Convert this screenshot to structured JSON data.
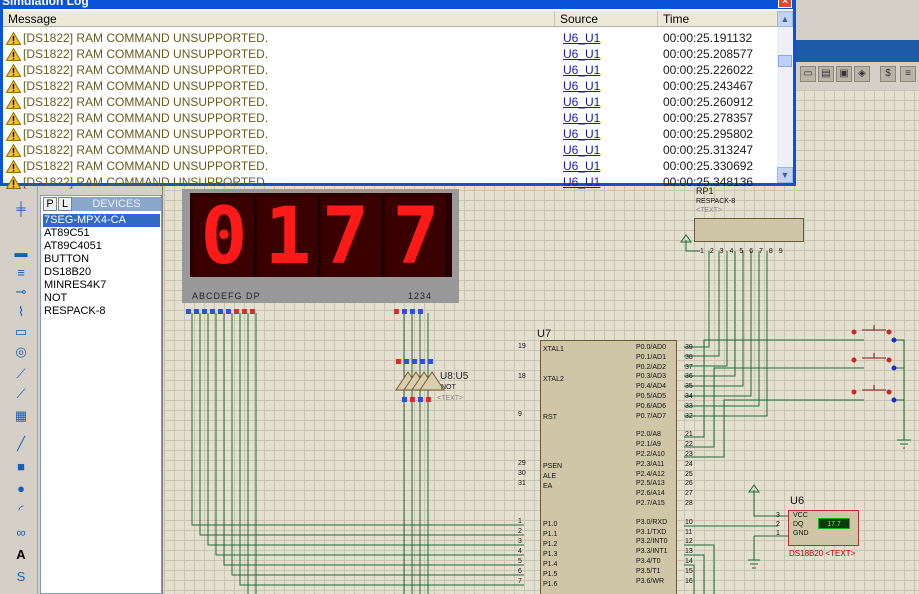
{
  "log": {
    "title": "Simulation Log",
    "columns": [
      "Message",
      "Source",
      "Time"
    ],
    "rows": [
      {
        "message": "[DS1822] RAM COMMAND UNSUPPORTED.",
        "source": "U6_U1",
        "time": "00:00:25.191132"
      },
      {
        "message": "[DS1822] RAM COMMAND UNSUPPORTED.",
        "source": "U6_U1",
        "time": "00:00:25.208577"
      },
      {
        "message": "[DS1822] RAM COMMAND UNSUPPORTED.",
        "source": "U6_U1",
        "time": "00:00:25.226022"
      },
      {
        "message": "[DS1822] RAM COMMAND UNSUPPORTED.",
        "source": "U6_U1",
        "time": "00:00:25.243467"
      },
      {
        "message": "[DS1822] RAM COMMAND UNSUPPORTED.",
        "source": "U6_U1",
        "time": "00:00:25.260912"
      },
      {
        "message": "[DS1822] RAM COMMAND UNSUPPORTED.",
        "source": "U6_U1",
        "time": "00:00:25.278357"
      },
      {
        "message": "[DS1822] RAM COMMAND UNSUPPORTED.",
        "source": "U6_U1",
        "time": "00:00:25.295802"
      },
      {
        "message": "[DS1822] RAM COMMAND UNSUPPORTED.",
        "source": "U6_U1",
        "time": "00:00:25.313247"
      },
      {
        "message": "[DS1822] RAM COMMAND UNSUPPORTED.",
        "source": "U6_U1",
        "time": "00:00:25.330692"
      },
      {
        "message": "[DS1822] RAM COMMAND UNSUPPORTED.",
        "source": "U6_U1",
        "time": "00:00:25.348136"
      }
    ],
    "close_glyph": "×",
    "scroll_up": "▲",
    "scroll_down": "▼"
  },
  "devices": {
    "tab_p": "P",
    "tab_l": "L",
    "header": "DEVICES",
    "items": [
      "7SEG-MPX4-CA",
      "AT89C51",
      "AT89C4051",
      "BUTTON",
      "DS18B20",
      "MINRES4K7",
      "NOT",
      "RESPACK-8"
    ],
    "selected_index": 0
  },
  "display": {
    "digits": [
      "0",
      "1",
      "7.",
      "7"
    ],
    "segment_label": "ABCDEFG  DP",
    "digit_label": "1234"
  },
  "mcu": {
    "ref": "U7",
    "left_pins": [
      {
        "num": "19",
        "name": "XTAL1"
      },
      {
        "num": "18",
        "name": "XTAL2"
      },
      {
        "num": "9",
        "name": "RST"
      },
      {
        "num": "29",
        "name": "PSEN"
      },
      {
        "num": "30",
        "name": "ALE"
      },
      {
        "num": "31",
        "name": "EA"
      },
      {
        "num": "1",
        "name": "P1.0"
      },
      {
        "num": "2",
        "name": "P1.1"
      },
      {
        "num": "3",
        "name": "P1.2"
      },
      {
        "num": "4",
        "name": "P1.3"
      },
      {
        "num": "5",
        "name": "P1.4"
      },
      {
        "num": "6",
        "name": "P1.5"
      },
      {
        "num": "7",
        "name": "P1.6"
      }
    ],
    "right_pins": [
      {
        "num": "39",
        "name": "P0.0/AD0"
      },
      {
        "num": "38",
        "name": "P0.1/AD1"
      },
      {
        "num": "37",
        "name": "P0.2/AD2"
      },
      {
        "num": "36",
        "name": "P0.3/AD3"
      },
      {
        "num": "35",
        "name": "P0.4/AD4"
      },
      {
        "num": "34",
        "name": "P0.5/AD5"
      },
      {
        "num": "33",
        "name": "P0.6/AD6"
      },
      {
        "num": "32",
        "name": "P0.7/AD7"
      },
      {
        "num": "21",
        "name": "P2.0/A8"
      },
      {
        "num": "22",
        "name": "P2.1/A9"
      },
      {
        "num": "23",
        "name": "P2.2/A10"
      },
      {
        "num": "24",
        "name": "P2.3/A11"
      },
      {
        "num": "25",
        "name": "P2.4/A12"
      },
      {
        "num": "26",
        "name": "P2.5/A13"
      },
      {
        "num": "27",
        "name": "P2.6/A14"
      },
      {
        "num": "28",
        "name": "P2.7/A15"
      },
      {
        "num": "10",
        "name": "P3.0/RXD"
      },
      {
        "num": "11",
        "name": "P3.1/TXD"
      },
      {
        "num": "12",
        "name": "P3.2/INT0"
      },
      {
        "num": "13",
        "name": "P3.3/INT1"
      },
      {
        "num": "14",
        "name": "P3.4/T0"
      },
      {
        "num": "15",
        "name": "P3.5/T1"
      },
      {
        "num": "16",
        "name": "P3.6/WR"
      }
    ]
  },
  "respack": {
    "ref": "RP1",
    "part": "RESPACK-8",
    "text": "<TEXT>",
    "pins": "1 2 3 4 5 6 7 8 9"
  },
  "sensor": {
    "ref": "U6",
    "part": "DS18B20",
    "text": "<TEXT>",
    "reading": "17.7",
    "pins": [
      {
        "num": "3",
        "name": "VCC"
      },
      {
        "num": "2",
        "name": "DQ"
      },
      {
        "num": "1",
        "name": "GND"
      }
    ]
  },
  "inverter": {
    "ref": "U8:U5",
    "part": "NOT",
    "text": "<TEXT>"
  }
}
